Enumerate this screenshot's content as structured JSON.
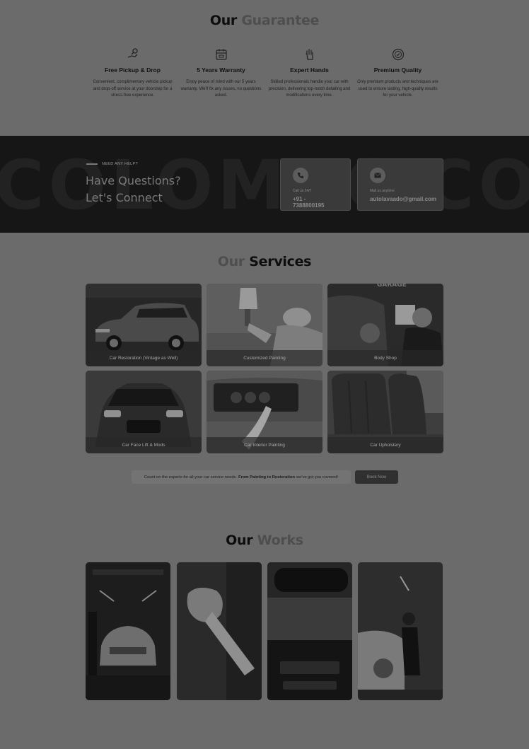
{
  "guarantee": {
    "title_dark": "Our",
    "title_dim": "Guarantee",
    "features": [
      {
        "icon": "hand-key-icon",
        "title": "Free Pickup & Drop",
        "text": "Convenient, complimentary vehicle pickup and drop-off service at your doorstep for a stress-free experience."
      },
      {
        "icon": "calendar-icon",
        "title": "5 Years Warranty",
        "text": "Enjoy peace of mind with our 5 years warranty. We'll fix any issues, no questions asked."
      },
      {
        "icon": "hand-icon",
        "title": "Expert Hands",
        "text": "Skilled professionals handle your car with precision, delivering top-notch detailing and modifications every time."
      },
      {
        "icon": "quality-badge-icon",
        "title": "Premium Quality",
        "text": "Only premium products and techniques are used to ensure lasting, high-quality results for your vehicle."
      }
    ]
  },
  "banner": {
    "bg_word": "COLOMBO",
    "bg_word_right": "CO",
    "eyebrow": "NEED ANY HELP?",
    "title_line1": "Have Questions?",
    "title_line2": "Let's Connect",
    "call": {
      "icon": "phone-icon",
      "label": "Call us 24/7",
      "value": "+91 - 7388800195"
    },
    "mail": {
      "icon": "mail-icon",
      "label": "Mail us anytime",
      "value": "autolavaado@gmail.com"
    }
  },
  "services": {
    "title_dim": "Our",
    "title_dark": "Services",
    "items": [
      {
        "label": "Car Restoration (Vintage as Well)"
      },
      {
        "label": "Customized Painting"
      },
      {
        "label": "Body Shop"
      },
      {
        "label": "Car Face Lift & Mods"
      },
      {
        "label": "Car Interior Painting"
      },
      {
        "label": "Car Upholstery"
      }
    ],
    "cta_text_before": "Count on the experts for all your car service needs.",
    "cta_text_bold": "From Painting to Restoration",
    "cta_text_after": "we've got you covered!",
    "book_label": "Book Now"
  },
  "works": {
    "title_dark": "Our",
    "title_dim": "Works"
  }
}
